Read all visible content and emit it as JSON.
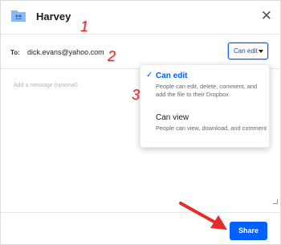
{
  "header": {
    "title": "Harvey",
    "close_glyph": "✕",
    "folder_icon": "shared-folder-icon"
  },
  "recipients": {
    "to_label": "To:",
    "email": "dick.evans@yahoo.com"
  },
  "permission": {
    "selected": "Can edit"
  },
  "message": {
    "placeholder": "Add a message (optional)"
  },
  "dropdown": {
    "options": [
      {
        "title": "Can edit",
        "description": "People can edit, delete, comment, and add the file to their Dropbox",
        "checked": true
      },
      {
        "title": "Can view",
        "description": "People can view, download, and comment",
        "checked": false
      }
    ]
  },
  "footer": {
    "share_label": "Share"
  },
  "annotations": {
    "n1": "1",
    "n2": "2",
    "n3": "3"
  },
  "colors": {
    "accent": "#0061fe",
    "annotation": "#e52c2c",
    "folder": "#8bb9f5"
  }
}
